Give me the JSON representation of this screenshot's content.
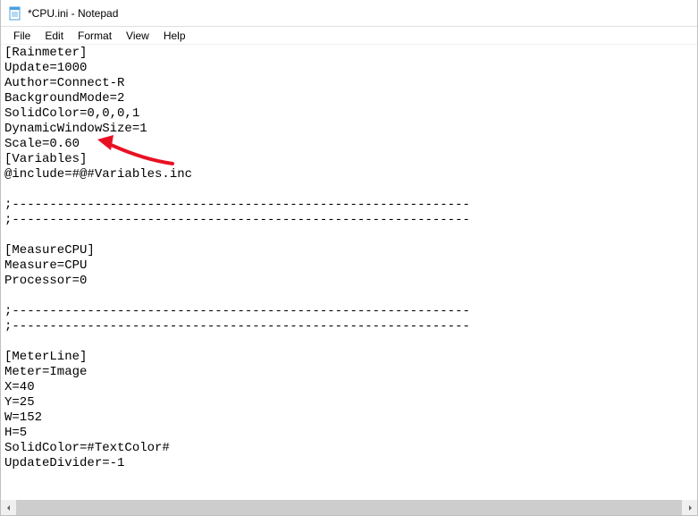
{
  "titlebar": {
    "title": "*CPU.ini - Notepad"
  },
  "menubar": {
    "file": "File",
    "edit": "Edit",
    "format": "Format",
    "view": "View",
    "help": "Help"
  },
  "editor": {
    "content": "[Rainmeter]\nUpdate=1000\nAuthor=Connect-R\nBackgroundMode=2\nSolidColor=0,0,0,1\nDynamicWindowSize=1\nScale=0.60\n[Variables]\n@include=#@#Variables.inc\n\n;-------------------------------------------------------------\n;-------------------------------------------------------------\n\n[MeasureCPU]\nMeasure=CPU\nProcessor=0\n\n;-------------------------------------------------------------\n;-------------------------------------------------------------\n\n[MeterLine]\nMeter=Image\nX=40\nY=25\nW=152\nH=5\nSolidColor=#TextColor#\nUpdateDivider=-1"
  },
  "annotation": {
    "color": "#e81123",
    "target_line": "Scale=0.60"
  }
}
